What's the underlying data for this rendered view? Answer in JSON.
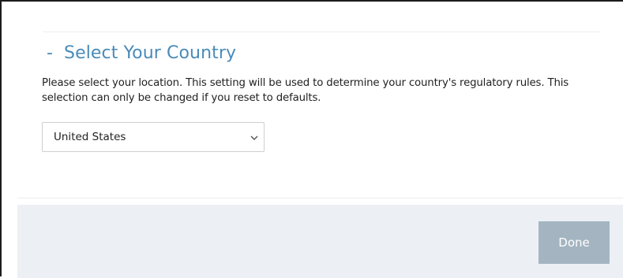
{
  "section": {
    "collapse_marker": "-",
    "title": "Select Your Country",
    "description": "Please select your location. This setting will be used to determine your country's regulatory rules. This selection can only be changed if you reset to defaults."
  },
  "country_select": {
    "selected_value": "United States",
    "icon": "chevron-down-icon"
  },
  "footer": {
    "done_label": "Done"
  },
  "colors": {
    "heading": "#4a8bb8",
    "footer_background": "#ecf0f5",
    "done_button": "#a4b5c1"
  }
}
